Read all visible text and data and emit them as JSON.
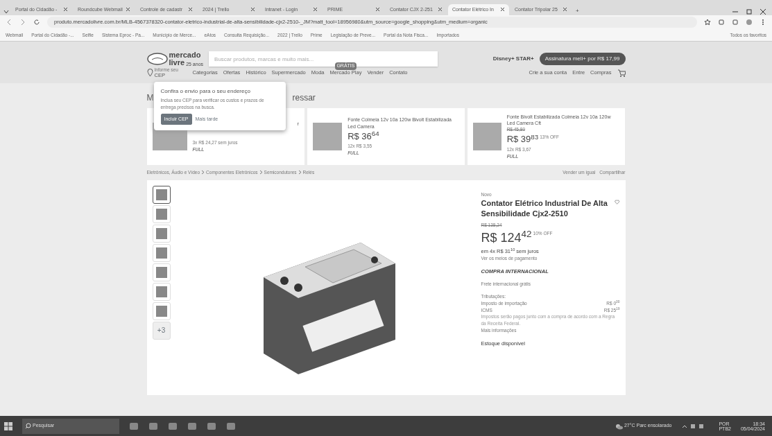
{
  "browser": {
    "tabs": [
      {
        "title": "Portal do Cidadão -",
        "selected": false
      },
      {
        "title": "Roundcube Webmail",
        "selected": false
      },
      {
        "title": "Controle de cadastr",
        "selected": false
      },
      {
        "title": "2024 | Trello",
        "selected": false
      },
      {
        "title": "Intranet - Login",
        "selected": false
      },
      {
        "title": "PRIME",
        "selected": false
      },
      {
        "title": "Contator CJX 2-251",
        "selected": false
      },
      {
        "title": "Contator Elétrico In",
        "selected": true
      },
      {
        "title": "Contator Tripolar 25",
        "selected": false
      }
    ],
    "new_tab": "+",
    "url": "produto.mercadolivre.com.br/MLB-4567378320-contator-eletrico-industrial-de-alta-sensibilidade-cjx2-2510-_JM?matt_tool=18956980&utm_source=google_shopping&utm_medium=organic",
    "bookmarks": [
      "Webmail",
      "Portal do Cidadão -...",
      "Selfie",
      "Sistema Eproc - Pa...",
      "Município de Merce...",
      "eAtos",
      "Consulta Requisição...",
      "2022 | Trello",
      "Prime",
      "Legislação de Preve...",
      "Portal da Nota Fisca...",
      "Importados"
    ],
    "all_bookmarks": "Todos os favoritos"
  },
  "header": {
    "logo": "mercado",
    "logo2": "livre",
    "anniversary": "25 anos",
    "search": {
      "placeholder": "Buscar produtos, marcas e muito mais..."
    },
    "promo_brand": "Disney+ STAR+",
    "promo": "Assinatura meli+ por R$ 17,99",
    "location_hint": "Informe seu",
    "location": "CEP",
    "nav": [
      {
        "label": "Categorias"
      },
      {
        "label": "Ofertas"
      },
      {
        "label": "Histórico"
      },
      {
        "label": "Supermercado"
      },
      {
        "label": "Moda"
      },
      {
        "label": "Mercado Play",
        "badge": "GRÁTIS"
      },
      {
        "label": "Vender"
      },
      {
        "label": "Contato"
      }
    ],
    "account": [
      "Crie a sua conta",
      "Entre",
      "Compras"
    ]
  },
  "section_title_start": "M",
  "section_title_end": "ressar",
  "popup": {
    "title": "Confira o envio para o seu endereço",
    "text": "Inclua seu CEP para verificar os custos e prazos de entrega precisos na busca.",
    "primary": "Incluir CEP",
    "secondary": "Mais tarde"
  },
  "products": [
    {
      "title": "r",
      "installments": "3x R$ 24,27 sem juros",
      "shipping": "FULL"
    },
    {
      "title": "Fonte Colmeia 12v 10a 120w Bivolt Estabilizada Led Camera",
      "price": "R$ 36",
      "cents": "64",
      "installments": "12x R$ 3,55",
      "shipping": "FULL"
    },
    {
      "title": "Fonte Bivolt Estabilizada Colmeia 12v 10a 120w Led Camera Cft",
      "old_price": "R$ 45,80",
      "price": "R$ 39",
      "cents": "83",
      "discount": "13% OFF",
      "installments": "12x R$ 3,67",
      "shipping": "FULL"
    }
  ],
  "breadcrumb": [
    "Eletrônicos, Áudio e Vídeo",
    "Componentes Eletrônicos",
    "Semicondutores",
    "Relés"
  ],
  "page_actions": [
    "Vender um igual",
    "Compartilhar"
  ],
  "gallery": {
    "thumbnails": [
      {
        "selected": true
      },
      {
        "selected": false
      },
      {
        "selected": false
      },
      {
        "selected": false
      },
      {
        "selected": false
      },
      {
        "selected": false
      },
      {
        "selected": false
      }
    ],
    "more": "+3"
  },
  "item": {
    "condition": "Novo",
    "title": "Contator Elétrico Industrial De Alta Sensibilidade Cjx2-2510",
    "old_price": "R$ 138,24",
    "price": "R$ 124",
    "cents": "42",
    "discount": "10% OFF",
    "installments": "em 4x R$ 31$^{10}$ sem juros",
    "payment_link": "Ver os meios de pagamento",
    "tag": "COMPRA INTERNACIONAL",
    "shipping": "Frete internacional grátis",
    "taxes_title": "Tributações:",
    "taxes": [
      {
        "name": "Imposto de importação",
        "value": "R$ 0$^{00}$"
      },
      {
        "name": "ICMS",
        "value": "R$ 25$^{19}$"
      }
    ],
    "tax_note": "Impostos serão pagos junto com a compra de acordo com a Regra da Receita Federal.",
    "more_info": "Mais informações",
    "stock": "Estoque disponível"
  },
  "taskbar": {
    "search": "Pesquisar",
    "weather": "27°C Parc ensolarado",
    "lang": "POR",
    "layout": "PTB2",
    "time": "18:34",
    "date": "05/04/2024"
  }
}
